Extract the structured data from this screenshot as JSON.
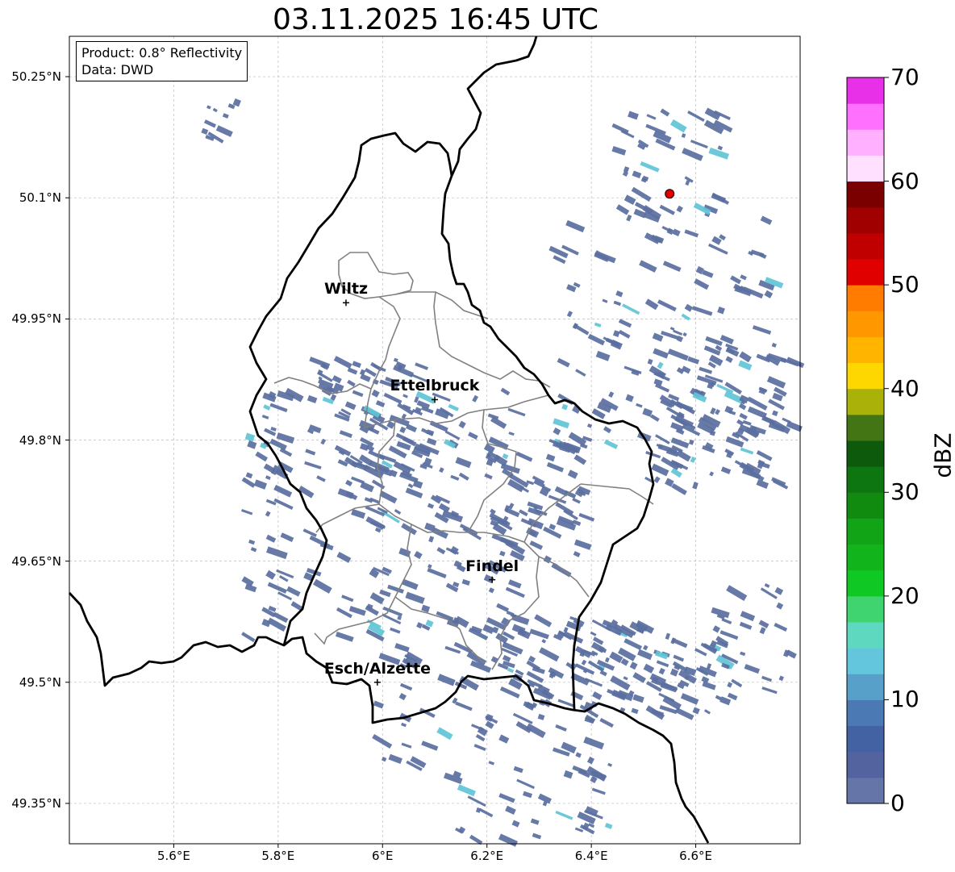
{
  "title": "03.11.2025 16:45 UTC",
  "info": {
    "product": "Product: 0.8° Reflectivity",
    "data": "Data: DWD"
  },
  "cities": [
    {
      "name": "Wiltz",
      "lon": 5.93,
      "lat": 49.97
    },
    {
      "name": "Ettelbruck",
      "lon": 6.1,
      "lat": 49.85
    },
    {
      "name": "Findel",
      "lon": 6.21,
      "lat": 49.627
    },
    {
      "name": "Esch/Alzette",
      "lon": 5.99,
      "lat": 49.5
    }
  ],
  "radar_site": {
    "lon": 6.55,
    "lat": 50.105,
    "color": "#e00000"
  },
  "axes": {
    "lon_ticks": [
      {
        "v": 5.6,
        "label": "5.6°E"
      },
      {
        "v": 5.8,
        "label": "5.8°E"
      },
      {
        "v": 6.0,
        "label": "6°E"
      },
      {
        "v": 6.2,
        "label": "6.2°E"
      },
      {
        "v": 6.4,
        "label": "6.4°E"
      },
      {
        "v": 6.6,
        "label": "6.6°E"
      }
    ],
    "lat_ticks": [
      {
        "v": 50.25,
        "label": "50.25°N"
      },
      {
        "v": 50.1,
        "label": "50.1°N"
      },
      {
        "v": 49.95,
        "label": "49.95°N"
      },
      {
        "v": 49.8,
        "label": "49.8°N"
      },
      {
        "v": 49.65,
        "label": "49.65°N"
      },
      {
        "v": 49.5,
        "label": "49.5°N"
      },
      {
        "v": 49.35,
        "label": "49.35°N"
      }
    ],
    "lon_range": [
      5.4,
      6.8
    ],
    "lat_range": [
      49.3,
      50.3
    ]
  },
  "colorbar": {
    "label": "dBZ",
    "min": 0,
    "max": 70,
    "step": 2.5,
    "ticks": [
      "0",
      "10",
      "20",
      "30",
      "40",
      "50",
      "60",
      "70"
    ],
    "colors": [
      "#6575a8",
      "#5263a0",
      "#4262a3",
      "#4a79b3",
      "#57a0c9",
      "#64c6dd",
      "#5fd8c0",
      "#3fd470",
      "#10c824",
      "#11b51b",
      "#10a416",
      "#108b10",
      "#0e7610",
      "#0d5a0c",
      "#437515",
      "#aab108",
      "#ffd700",
      "#ffb400",
      "#ff9800",
      "#ff7c00",
      "#e00000",
      "#c00000",
      "#a00000",
      "#7a0000",
      "#ffe0ff",
      "#ffb0ff",
      "#ff70ff",
      "#e830e8"
    ]
  },
  "colors": {
    "rain": "#5a6fa0",
    "rain_light": "#5fc4d6",
    "border": "#000000",
    "canton": "#808080",
    "grid": "#bbbbbb"
  }
}
